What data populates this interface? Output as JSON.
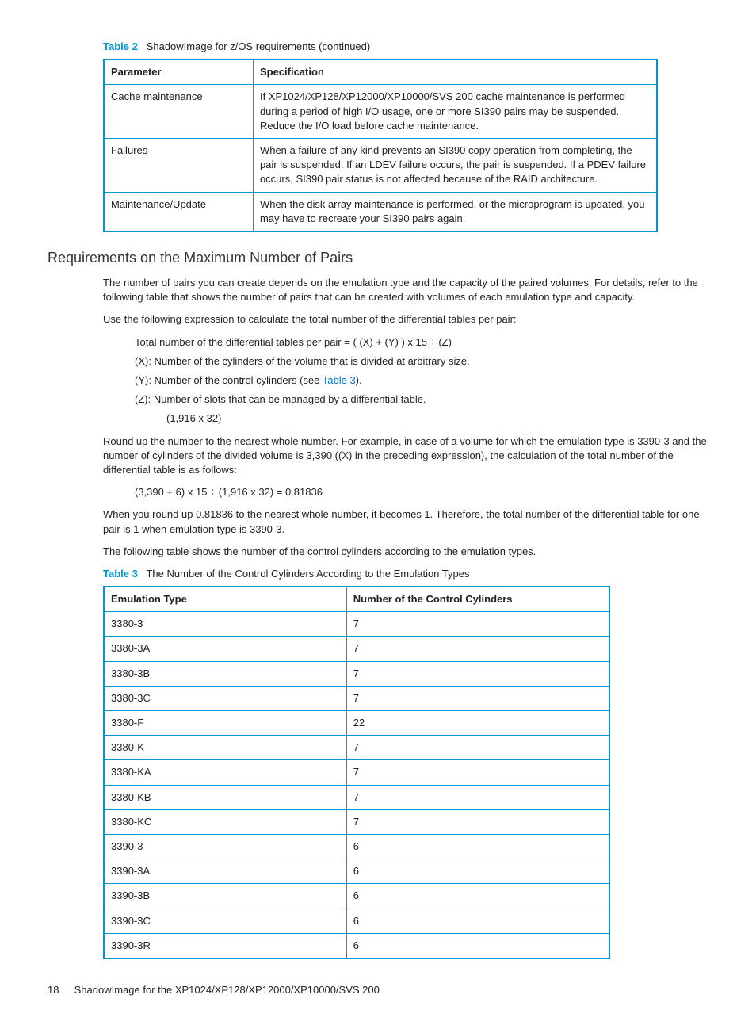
{
  "table2": {
    "label": "Table 2",
    "caption": "ShadowImage for z/OS requirements (continued)",
    "headers": [
      "Parameter",
      "Specification"
    ],
    "rows": [
      {
        "param": "Cache maintenance",
        "spec": "If XP1024/XP128/XP12000/XP10000/SVS 200 cache maintenance is performed during a period of high I/O usage, one or more SI390 pairs may be suspended. Reduce the I/O load before cache maintenance."
      },
      {
        "param": "Failures",
        "spec": "When a failure of any kind prevents an SI390 copy operation from completing, the pair is suspended. If an LDEV failure occurs, the pair is suspended. If a PDEV failure occurs, SI390 pair status is not affected because of the RAID architecture."
      },
      {
        "param": "Maintenance/Update",
        "spec": "When the disk array maintenance is performed, or the microprogram is updated, you may have to recreate your SI390 pairs again."
      }
    ]
  },
  "section": {
    "heading": "Requirements on the Maximum Number of Pairs",
    "p1": "The number of pairs you can create depends on the emulation type and the capacity of the paired volumes. For details, refer to the following table that shows the number of pairs that can be created with volumes of each emulation type and capacity.",
    "p2": "Use the following expression to calculate the total number of the differential tables per pair:",
    "expr": "Total number of the differential tables per pair = ( (X) + (Y) ) x 15 ÷ (Z)",
    "x": "(X): Number of the cylinders of the volume that is divided at arbitrary size.",
    "y_pre": "(Y): Number of the control cylinders (see ",
    "y_link": "Table 3",
    "y_post": ").",
    "z": "(Z): Number of slots that can be managed by a differential table.",
    "zval": "(1,916 x 32)",
    "p3": "Round up the number to the nearest whole number. For example, in case of a volume for which the emulation type is 3390-3 and the number of cylinders of the divided volume is 3,390 ((X) in the preceding expression), the calculation of the total number of the differential table is as follows:",
    "calc": "(3,390 + 6) x 15 ÷ (1,916 x 32) = 0.81836",
    "p4": "When you round up 0.81836 to the nearest whole number, it becomes 1. Therefore, the total number of the differential table for one pair is 1 when emulation type is 3390-3.",
    "p5": "The following table shows the number of the control cylinders according to the emulation types."
  },
  "table3": {
    "label": "Table 3",
    "caption": "The Number of the Control Cylinders According to the Emulation Types",
    "headers": [
      "Emulation Type",
      "Number of the Control Cylinders"
    ],
    "rows": [
      {
        "c0": "3380-3",
        "c1": "7"
      },
      {
        "c0": "3380-3A",
        "c1": "7"
      },
      {
        "c0": "3380-3B",
        "c1": "7"
      },
      {
        "c0": "3380-3C",
        "c1": "7"
      },
      {
        "c0": "3380-F",
        "c1": "22"
      },
      {
        "c0": "3380-K",
        "c1": "7"
      },
      {
        "c0": "3380-KA",
        "c1": "7"
      },
      {
        "c0": "3380-KB",
        "c1": "7"
      },
      {
        "c0": "3380-KC",
        "c1": "7"
      },
      {
        "c0": "3390-3",
        "c1": "6"
      },
      {
        "c0": "3390-3A",
        "c1": "6"
      },
      {
        "c0": "3390-3B",
        "c1": "6"
      },
      {
        "c0": "3390-3C",
        "c1": "6"
      },
      {
        "c0": "3390-3R",
        "c1": "6"
      }
    ]
  },
  "footer": {
    "page": "18",
    "title": "ShadowImage for the XP1024/XP128/XP12000/XP10000/SVS 200"
  }
}
